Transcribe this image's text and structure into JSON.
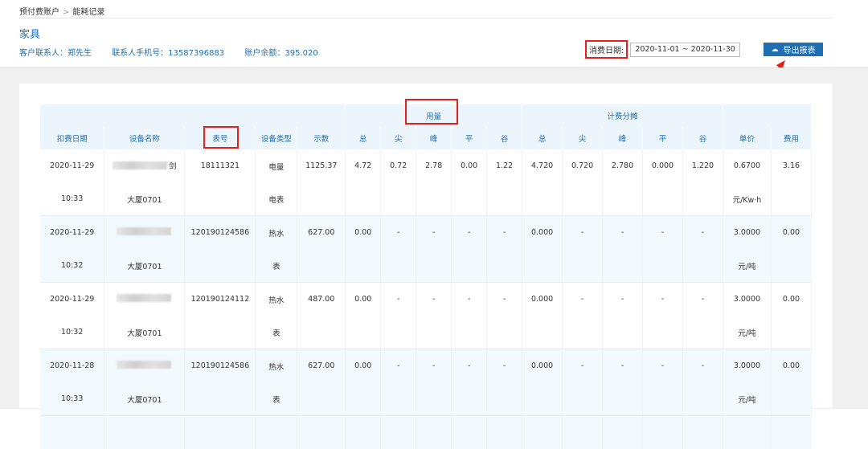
{
  "breadcrumb": {
    "parent": "预付费账户",
    "sep": ">",
    "current": "能耗记录"
  },
  "title": "家具",
  "info": {
    "contact": "客户联系人：郑先生",
    "phone": "联系人手机号：13587396883",
    "balance": "账户余额：395.020"
  },
  "date_filter": {
    "label": "消费日期:",
    "range": "2020-11-01  ~  2020-11-30"
  },
  "export_label": "导出报表",
  "table": {
    "group_usage": "用量",
    "group_share": "计费分摊",
    "headers": [
      "扣费日期",
      "设备名称",
      "表号",
      "设备类型",
      "示数",
      "总",
      "尖",
      "峰",
      "平",
      "谷",
      "总",
      "尖",
      "峰",
      "平",
      "谷",
      "单价",
      "费用"
    ],
    "rows": [
      {
        "date": "2020-11-29",
        "time": "10:33",
        "name_suffix": "剑",
        "name2": "大厦0701",
        "meter": "18111321",
        "type1": "电量",
        "type2": "电表",
        "reading": "1125.37",
        "u": [
          "4.72",
          "0.72",
          "2.78",
          "0.00",
          "1.22"
        ],
        "s": [
          "4.720",
          "0.720",
          "2.780",
          "0.000",
          "1.220"
        ],
        "price": "0.6700",
        "unit": "元/Kw·h",
        "fee": "3.16"
      },
      {
        "date": "2020-11-29",
        "time": "10:32",
        "name_suffix": "",
        "name2": "大厦0701",
        "meter": "120190124586",
        "type1": "热水",
        "type2": "表",
        "reading": "627.00",
        "u": [
          "0.00",
          "-",
          "-",
          "-",
          "-"
        ],
        "s": [
          "0.000",
          "-",
          "-",
          "-",
          "-"
        ],
        "price": "3.0000",
        "unit": "元/吨",
        "fee": "0.00"
      },
      {
        "date": "2020-11-29",
        "time": "10:32",
        "name_suffix": "",
        "name2": "大厦0701",
        "meter": "120190124112",
        "type1": "热水",
        "type2": "表",
        "reading": "487.00",
        "u": [
          "0.00",
          "-",
          "-",
          "-",
          "-"
        ],
        "s": [
          "0.000",
          "-",
          "-",
          "-",
          "-"
        ],
        "price": "3.0000",
        "unit": "元/吨",
        "fee": "0.00"
      },
      {
        "date": "2020-11-28",
        "time": "10:33",
        "name_suffix": "",
        "name2": "大厦0701",
        "meter": "120190124586",
        "type1": "热水",
        "type2": "表",
        "reading": "627.00",
        "u": [
          "0.00",
          "-",
          "-",
          "-",
          "-"
        ],
        "s": [
          "0.000",
          "-",
          "-",
          "-",
          "-"
        ],
        "price": "3.0000",
        "unit": "元/吨",
        "fee": "0.00"
      }
    ]
  }
}
